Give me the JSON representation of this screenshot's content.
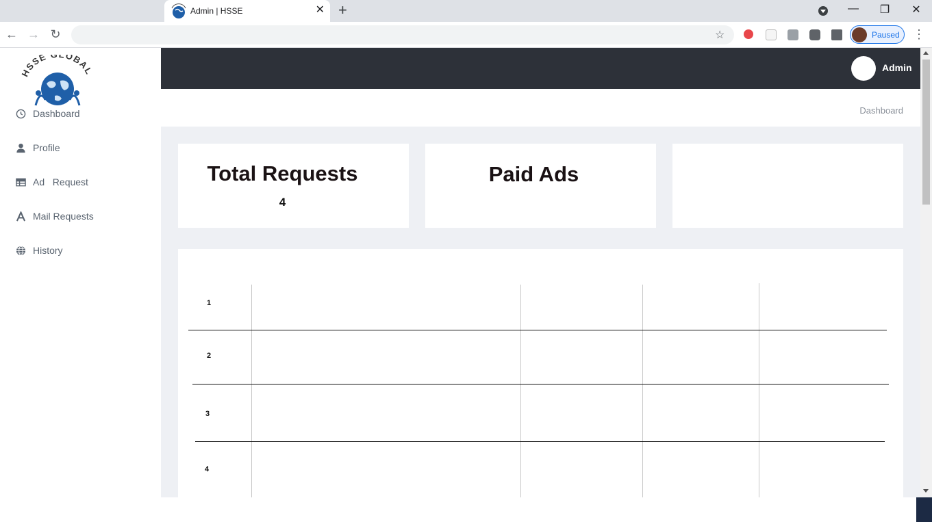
{
  "browser": {
    "tab_title": "Admin | HSSE",
    "tab_close": "✕",
    "new_tab": "+",
    "profile_status": "Paused",
    "window_controls": {
      "minimize": "—",
      "restore": "❐",
      "close": "✕"
    },
    "nav": {
      "back": "←",
      "forward": "→",
      "reload": "↻",
      "bookmark": "☆",
      "menu": "⋮"
    }
  },
  "logo": {
    "text": "HSSE GLOBAL"
  },
  "header": {
    "user_name": "Admin"
  },
  "breadcrumb": {
    "current": "Dashboard"
  },
  "sidebar": {
    "items": [
      {
        "label": "Dashboard",
        "icon": "clock-icon"
      },
      {
        "label": "Profile",
        "icon": "user-icon"
      },
      {
        "label": "Ad   Request",
        "icon": "table-icon"
      },
      {
        "label": "Mail Requests",
        "icon": "font-a-icon"
      },
      {
        "label": "History",
        "icon": "globe-icon"
      }
    ]
  },
  "cards": [
    {
      "title": "Total Requests",
      "value": "4"
    },
    {
      "title": "Paid Ads",
      "value": ""
    },
    {
      "title": "",
      "value": ""
    }
  ],
  "table": {
    "rows": [
      {
        "number": "1"
      },
      {
        "number": "2"
      },
      {
        "number": "3"
      },
      {
        "number": "4"
      }
    ]
  },
  "colors": {
    "header_bg": "#2d3139",
    "main_bg": "#eef0f4",
    "sidebar_text": "#5a6470",
    "logo_blue": "#1f5fa8"
  }
}
